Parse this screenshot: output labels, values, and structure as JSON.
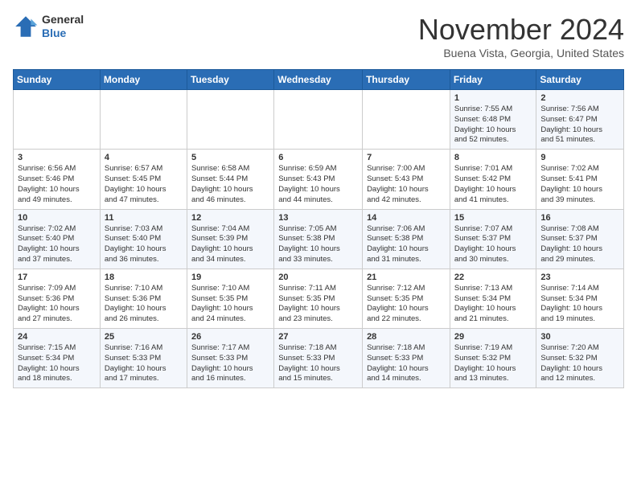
{
  "logo": {
    "general": "General",
    "blue": "Blue"
  },
  "header": {
    "month": "November 2024",
    "location": "Buena Vista, Georgia, United States"
  },
  "weekdays": [
    "Sunday",
    "Monday",
    "Tuesday",
    "Wednesday",
    "Thursday",
    "Friday",
    "Saturday"
  ],
  "weeks": [
    [
      {
        "day": "",
        "info": ""
      },
      {
        "day": "",
        "info": ""
      },
      {
        "day": "",
        "info": ""
      },
      {
        "day": "",
        "info": ""
      },
      {
        "day": "",
        "info": ""
      },
      {
        "day": "1",
        "info": "Sunrise: 7:55 AM\nSunset: 6:48 PM\nDaylight: 10 hours\nand 52 minutes."
      },
      {
        "day": "2",
        "info": "Sunrise: 7:56 AM\nSunset: 6:47 PM\nDaylight: 10 hours\nand 51 minutes."
      }
    ],
    [
      {
        "day": "3",
        "info": "Sunrise: 6:56 AM\nSunset: 5:46 PM\nDaylight: 10 hours\nand 49 minutes."
      },
      {
        "day": "4",
        "info": "Sunrise: 6:57 AM\nSunset: 5:45 PM\nDaylight: 10 hours\nand 47 minutes."
      },
      {
        "day": "5",
        "info": "Sunrise: 6:58 AM\nSunset: 5:44 PM\nDaylight: 10 hours\nand 46 minutes."
      },
      {
        "day": "6",
        "info": "Sunrise: 6:59 AM\nSunset: 5:43 PM\nDaylight: 10 hours\nand 44 minutes."
      },
      {
        "day": "7",
        "info": "Sunrise: 7:00 AM\nSunset: 5:43 PM\nDaylight: 10 hours\nand 42 minutes."
      },
      {
        "day": "8",
        "info": "Sunrise: 7:01 AM\nSunset: 5:42 PM\nDaylight: 10 hours\nand 41 minutes."
      },
      {
        "day": "9",
        "info": "Sunrise: 7:02 AM\nSunset: 5:41 PM\nDaylight: 10 hours\nand 39 minutes."
      }
    ],
    [
      {
        "day": "10",
        "info": "Sunrise: 7:02 AM\nSunset: 5:40 PM\nDaylight: 10 hours\nand 37 minutes."
      },
      {
        "day": "11",
        "info": "Sunrise: 7:03 AM\nSunset: 5:40 PM\nDaylight: 10 hours\nand 36 minutes."
      },
      {
        "day": "12",
        "info": "Sunrise: 7:04 AM\nSunset: 5:39 PM\nDaylight: 10 hours\nand 34 minutes."
      },
      {
        "day": "13",
        "info": "Sunrise: 7:05 AM\nSunset: 5:38 PM\nDaylight: 10 hours\nand 33 minutes."
      },
      {
        "day": "14",
        "info": "Sunrise: 7:06 AM\nSunset: 5:38 PM\nDaylight: 10 hours\nand 31 minutes."
      },
      {
        "day": "15",
        "info": "Sunrise: 7:07 AM\nSunset: 5:37 PM\nDaylight: 10 hours\nand 30 minutes."
      },
      {
        "day": "16",
        "info": "Sunrise: 7:08 AM\nSunset: 5:37 PM\nDaylight: 10 hours\nand 29 minutes."
      }
    ],
    [
      {
        "day": "17",
        "info": "Sunrise: 7:09 AM\nSunset: 5:36 PM\nDaylight: 10 hours\nand 27 minutes."
      },
      {
        "day": "18",
        "info": "Sunrise: 7:10 AM\nSunset: 5:36 PM\nDaylight: 10 hours\nand 26 minutes."
      },
      {
        "day": "19",
        "info": "Sunrise: 7:10 AM\nSunset: 5:35 PM\nDaylight: 10 hours\nand 24 minutes."
      },
      {
        "day": "20",
        "info": "Sunrise: 7:11 AM\nSunset: 5:35 PM\nDaylight: 10 hours\nand 23 minutes."
      },
      {
        "day": "21",
        "info": "Sunrise: 7:12 AM\nSunset: 5:35 PM\nDaylight: 10 hours\nand 22 minutes."
      },
      {
        "day": "22",
        "info": "Sunrise: 7:13 AM\nSunset: 5:34 PM\nDaylight: 10 hours\nand 21 minutes."
      },
      {
        "day": "23",
        "info": "Sunrise: 7:14 AM\nSunset: 5:34 PM\nDaylight: 10 hours\nand 19 minutes."
      }
    ],
    [
      {
        "day": "24",
        "info": "Sunrise: 7:15 AM\nSunset: 5:34 PM\nDaylight: 10 hours\nand 18 minutes."
      },
      {
        "day": "25",
        "info": "Sunrise: 7:16 AM\nSunset: 5:33 PM\nDaylight: 10 hours\nand 17 minutes."
      },
      {
        "day": "26",
        "info": "Sunrise: 7:17 AM\nSunset: 5:33 PM\nDaylight: 10 hours\nand 16 minutes."
      },
      {
        "day": "27",
        "info": "Sunrise: 7:18 AM\nSunset: 5:33 PM\nDaylight: 10 hours\nand 15 minutes."
      },
      {
        "day": "28",
        "info": "Sunrise: 7:18 AM\nSunset: 5:33 PM\nDaylight: 10 hours\nand 14 minutes."
      },
      {
        "day": "29",
        "info": "Sunrise: 7:19 AM\nSunset: 5:32 PM\nDaylight: 10 hours\nand 13 minutes."
      },
      {
        "day": "30",
        "info": "Sunrise: 7:20 AM\nSunset: 5:32 PM\nDaylight: 10 hours\nand 12 minutes."
      }
    ]
  ]
}
